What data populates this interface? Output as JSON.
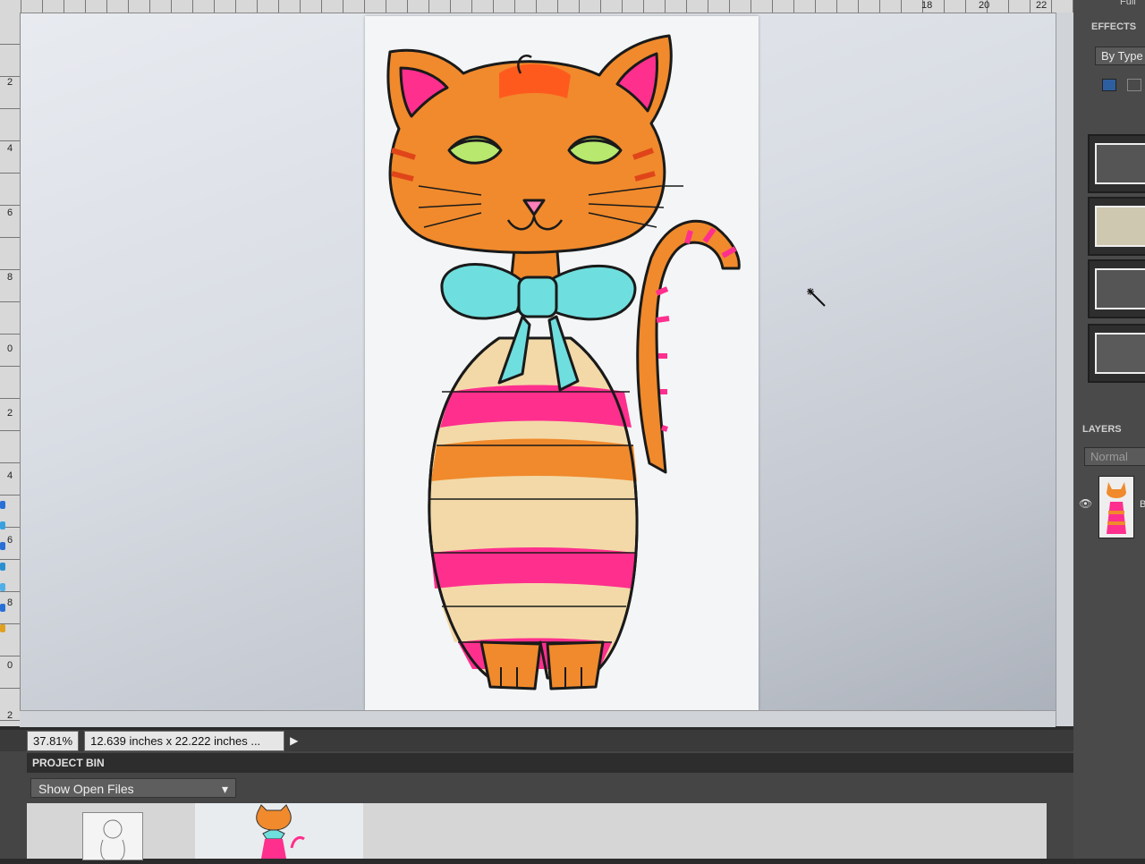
{
  "rulers": {
    "top_numbers": [
      "18",
      "20",
      "22"
    ],
    "left_numbers": [
      "2",
      "4",
      "6",
      "8",
      "0",
      "2",
      "4",
      "6",
      "8",
      "0",
      "2"
    ]
  },
  "status": {
    "zoom": "37.81%",
    "document_size": "12.639 inches x 22.222 inches ...",
    "arrow_icon": "play-arrow"
  },
  "project_bin": {
    "title": "PROJECT BIN",
    "dropdown_value": "Show Open Files"
  },
  "effects_panel": {
    "tab_label": "Full",
    "title": "EFFECTS",
    "filter_value": "By Type"
  },
  "layers_panel": {
    "title": "LAYERS",
    "blend_mode": "Normal",
    "layer_name": "B"
  },
  "colors": {
    "cat_orange": "#f08a2c",
    "cat_pink": "#ff2f8e",
    "cat_cream": "#f3d9a8",
    "bow_teal": "#6fdede",
    "eye_green": "#b8e86e",
    "outline": "#1a1a1a"
  }
}
